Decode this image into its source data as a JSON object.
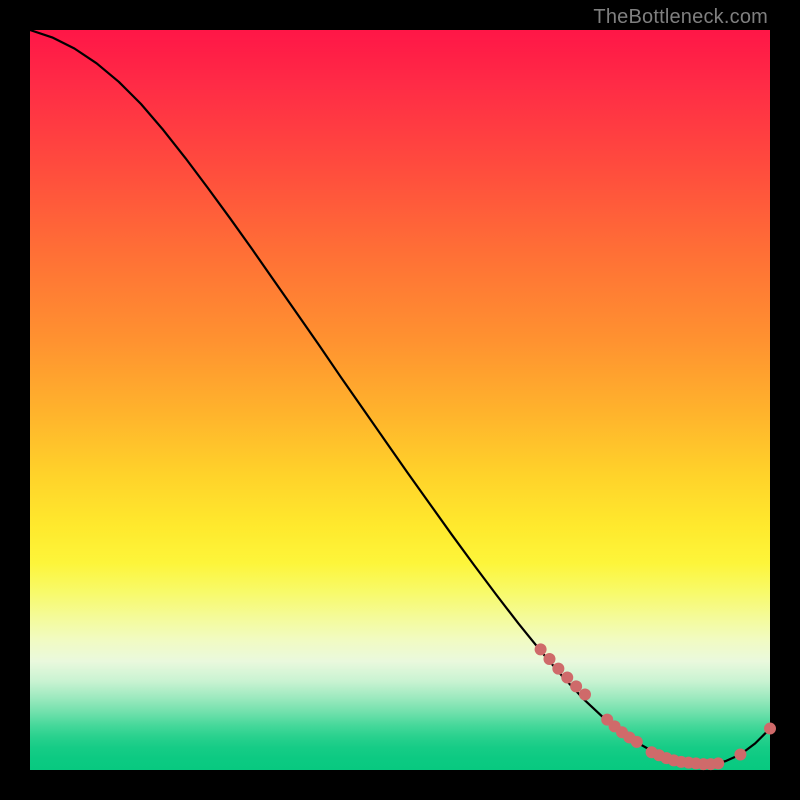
{
  "watermark": "TheBottleneck.com",
  "colors": {
    "curve": "#000000",
    "marker_fill": "#cf6a6a",
    "marker_stroke": "#cf6a6a"
  },
  "chart_data": {
    "type": "line",
    "title": "",
    "xlabel": "",
    "ylabel": "",
    "xlim": [
      0,
      100
    ],
    "ylim": [
      0,
      100
    ],
    "grid": false,
    "series": [
      {
        "name": "bottleneck-curve",
        "x": [
          0,
          3,
          6,
          9,
          12,
          15,
          18,
          21,
          24,
          27,
          30,
          33,
          36,
          39,
          42,
          45,
          48,
          51,
          54,
          57,
          60,
          63,
          66,
          69,
          72,
          75,
          78,
          81,
          84,
          86,
          88,
          90,
          92,
          94,
          96,
          98,
          100
        ],
        "y": [
          100,
          99,
          97.5,
          95.5,
          93,
          90,
          86.5,
          82.7,
          78.7,
          74.6,
          70.4,
          66.1,
          61.8,
          57.5,
          53.1,
          48.8,
          44.5,
          40.2,
          36,
          31.8,
          27.7,
          23.7,
          19.8,
          16.1,
          12.6,
          9.4,
          6.6,
          4.3,
          2.6,
          1.7,
          1.1,
          0.8,
          0.8,
          1.2,
          2.1,
          3.6,
          5.6
        ]
      }
    ],
    "markers": [
      {
        "name": "cluster-a",
        "points": [
          {
            "x": 69.0,
            "y": 16.3
          },
          {
            "x": 70.2,
            "y": 15.0
          },
          {
            "x": 71.4,
            "y": 13.7
          },
          {
            "x": 72.6,
            "y": 12.5
          },
          {
            "x": 73.8,
            "y": 11.3
          },
          {
            "x": 75.0,
            "y": 10.2
          }
        ]
      },
      {
        "name": "cluster-b",
        "points": [
          {
            "x": 78.0,
            "y": 6.8
          },
          {
            "x": 79.0,
            "y": 5.9
          },
          {
            "x": 80.0,
            "y": 5.1
          },
          {
            "x": 81.0,
            "y": 4.4
          },
          {
            "x": 82.0,
            "y": 3.8
          }
        ]
      },
      {
        "name": "flat-run",
        "points": [
          {
            "x": 84.0,
            "y": 2.4
          },
          {
            "x": 85.0,
            "y": 2.0
          },
          {
            "x": 86.0,
            "y": 1.6
          },
          {
            "x": 87.0,
            "y": 1.3
          },
          {
            "x": 88.0,
            "y": 1.1
          },
          {
            "x": 89.0,
            "y": 1.0
          },
          {
            "x": 90.0,
            "y": 0.9
          },
          {
            "x": 91.0,
            "y": 0.8
          },
          {
            "x": 92.0,
            "y": 0.8
          },
          {
            "x": 93.0,
            "y": 0.9
          }
        ]
      },
      {
        "name": "tail",
        "points": [
          {
            "x": 96.0,
            "y": 2.1
          },
          {
            "x": 100.0,
            "y": 5.6
          }
        ]
      }
    ]
  }
}
